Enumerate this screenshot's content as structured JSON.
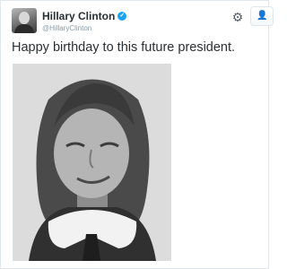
{
  "tweet": {
    "author": {
      "display_name": "Hillary Clinton",
      "handle": "@HillaryClinton",
      "verified": true,
      "avatar_icon": "profile-photo"
    },
    "text": "Happy birthday to this future president.",
    "actions": {
      "gear_icon": "gear-icon",
      "follow_icon": "follow-user-icon"
    },
    "media": {
      "type": "black-and-white photo",
      "subject": "edited portrait of a child with a grown man's face"
    }
  },
  "colors": {
    "text": "#292f33",
    "muted": "#8899a6",
    "accent": "#1da1f2",
    "border": "#e1e8ed"
  }
}
